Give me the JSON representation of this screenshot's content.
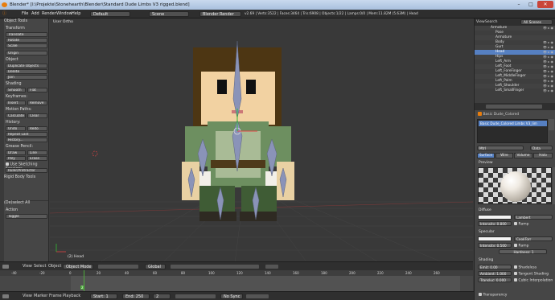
{
  "titlebar": {
    "title": "Blender* [I:\\Projekte\\Stonehearth\\Blender\\Standard Dude Limbs V3 rigged.blend]",
    "minimize": "–",
    "maximize": "□",
    "close": "✕"
  },
  "infobar": {
    "menus": [
      "File",
      "Add",
      "Render",
      "Window",
      "Help"
    ],
    "layout": "Default",
    "scene": "Scene",
    "engine": "Blender Render",
    "stats": "v2.69 | Verts:3522 | Faces:3464 | Tris:6908 | Objects:1/22 | Lamps:0/0 | Mem:11.82M (5.63M) | Head"
  },
  "toolshelf": {
    "header": "Object Tools",
    "transform": "Transform",
    "transform_buttons": [
      "Translate",
      "Rotate",
      "Scale",
      "Origin"
    ],
    "object": "Object",
    "object_buttons": [
      "Duplicate Objects",
      "Delete",
      "Join"
    ],
    "shading": "Shading",
    "smooth": "Smooth",
    "flat": "Flat",
    "keyframes": "Keyframes:",
    "insert": "Insert",
    "remove": "Remove",
    "motion_paths": "Motion Paths:",
    "calculate": "Calculate",
    "clear": "Clear",
    "history": "History:",
    "undo": "Undo",
    "redo": "Redo",
    "repeat_last": "Repeat Last",
    "history_btn": "History...",
    "grease_pencil": "Grease Pencil:",
    "draw": "Draw",
    "line": "Line",
    "poly": "Poly",
    "erase": "Erase",
    "use_sketching": "Use Sketching Sessions",
    "ruler": "Ruler/Protractor",
    "rigid_body": "Rigid Body Tools",
    "operator": "(De)select All",
    "action_label": "Action",
    "action_value": "Toggle"
  },
  "viewport": {
    "view_name": "User Ortho",
    "object_name": "(2) Head"
  },
  "viewhdr": {
    "view": "View",
    "select": "Select",
    "object": "Object",
    "mode": "Object Mode",
    "pivot": "Global"
  },
  "timeline": {
    "ticks": [
      "-40",
      "-20",
      "0",
      "20",
      "40",
      "60",
      "80",
      "100",
      "120",
      "140",
      "160",
      "180",
      "200",
      "220",
      "240",
      "260"
    ],
    "current_frame": "2"
  },
  "tlhdr": {
    "view": "View",
    "marker": "Marker",
    "frame": "Frame",
    "playback": "Playback",
    "start": "Start: 1",
    "end": "End: 250",
    "current": "2",
    "sync": "No Sync"
  },
  "outliner": {
    "view": "View",
    "search": "Search",
    "scenes": "All Scenes",
    "rows": [
      "Armature",
      "Pose",
      "Armature",
      "Body",
      "Gurt",
      "Head",
      "Hips",
      "Left_Arm",
      "Left_Foot",
      "Left_ForeFinger",
      "Left_MiddleFinger",
      "Left_Palm",
      "Left_Shoulder",
      "Left_SmallFinger"
    ]
  },
  "props": {
    "breadcrumb": "Basic Dude_Colored",
    "material_slot": "Basic Dude_Colored Limbs V3_lim",
    "material_name": "Mtrl",
    "data_label": "Data",
    "tabs": [
      "Surface",
      "Wire",
      "Volume",
      "Halo"
    ],
    "preview": "Preview",
    "diffuse": "Diffuse",
    "diffuse_shader": "Lambert",
    "intensity": "Intensity: 0.800",
    "ramp": "Ramp",
    "specular": "Specular",
    "spec_shader": "CookTorr",
    "spec_intensity": "Intensity: 0.500",
    "hardness": "Hardness: 1",
    "shading": "Shading",
    "emit": "Emit: 0.00",
    "ambient": "Ambient: 1.000",
    "translucency": "Transluc: 0.000",
    "shadeless": "Shadeless",
    "tangent": "Tangent Shading",
    "cubic": "Cubic Interpolation",
    "transparency": "Transparency"
  },
  "colors": {
    "accent": "#e87d0d",
    "selected": "#5680c2",
    "hair": "#4d3613",
    "skin": "#f2d2a2",
    "shirt": "#6d8f60",
    "pants": "#3f5c35",
    "bone": "#8a93b8"
  }
}
